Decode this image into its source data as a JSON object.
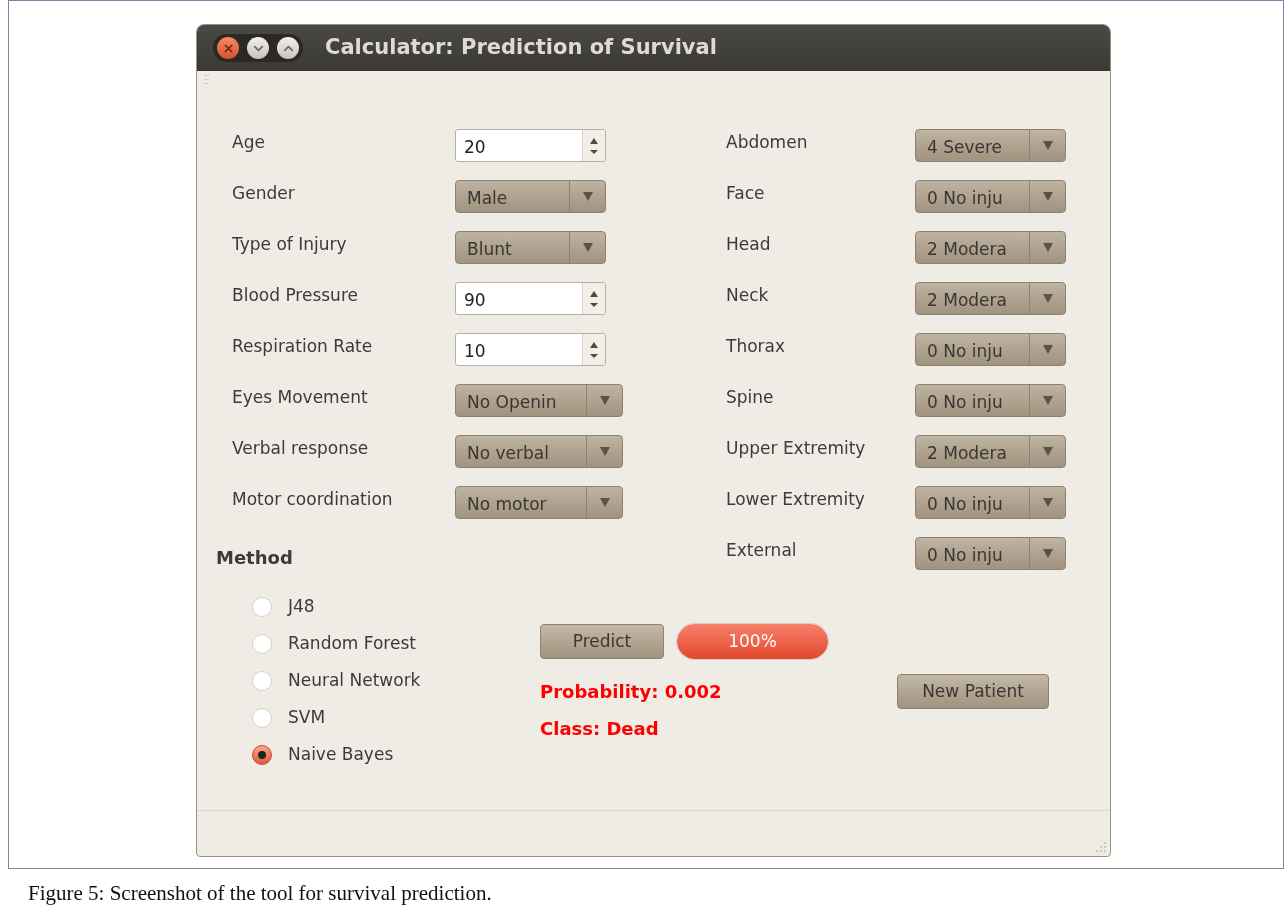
{
  "window": {
    "title": "Calculator: Prediction of Survival"
  },
  "fields_left": [
    {
      "label": "Age",
      "kind": "spin",
      "value": "20"
    },
    {
      "label": "Gender",
      "kind": "combo",
      "value": "Male"
    },
    {
      "label": "Type of Injury",
      "kind": "combo",
      "value": "Blunt"
    },
    {
      "label": "Blood Pressure",
      "kind": "spin",
      "value": "90"
    },
    {
      "label": "Respiration Rate",
      "kind": "spin",
      "value": "10"
    },
    {
      "label": "Eyes Movement",
      "kind": "wide_combo",
      "value": "No Openin"
    },
    {
      "label": "Verbal response",
      "kind": "wide_combo",
      "value": "No verbal"
    },
    {
      "label": "Motor coordination",
      "kind": "wide_combo",
      "value": "No motor"
    }
  ],
  "fields_right": [
    {
      "label": "Abdomen",
      "kind": "combo",
      "value": "4 Severe"
    },
    {
      "label": "Face",
      "kind": "combo",
      "value": "0 No inju"
    },
    {
      "label": "Head",
      "kind": "combo",
      "value": "2 Modera"
    },
    {
      "label": "Neck",
      "kind": "combo",
      "value": "2 Modera"
    },
    {
      "label": "Thorax",
      "kind": "combo",
      "value": "0 No inju"
    },
    {
      "label": "Spine",
      "kind": "combo",
      "value": "0 No inju"
    },
    {
      "label": "Upper Extremity",
      "kind": "combo",
      "value": "2 Modera"
    },
    {
      "label": "Lower Extremity",
      "kind": "combo",
      "value": "0 No inju"
    },
    {
      "label": "External",
      "kind": "combo",
      "value": "0 No inju"
    }
  ],
  "method": {
    "title": "Method",
    "options": [
      {
        "label": "J48",
        "selected": false
      },
      {
        "label": "Random Forest",
        "selected": false
      },
      {
        "label": "Neural Network",
        "selected": false
      },
      {
        "label": "SVM",
        "selected": false
      },
      {
        "label": "Naive Bayes",
        "selected": true
      }
    ]
  },
  "predict_button": "Predict",
  "progress": {
    "level": 1,
    "reading": "100%"
  },
  "results": [
    "Probability: 0.002",
    "Class: Dead"
  ],
  "new_patient_button": "New Patient",
  "caption": "Figure 5: Screenshot of the tool for survival prediction."
}
